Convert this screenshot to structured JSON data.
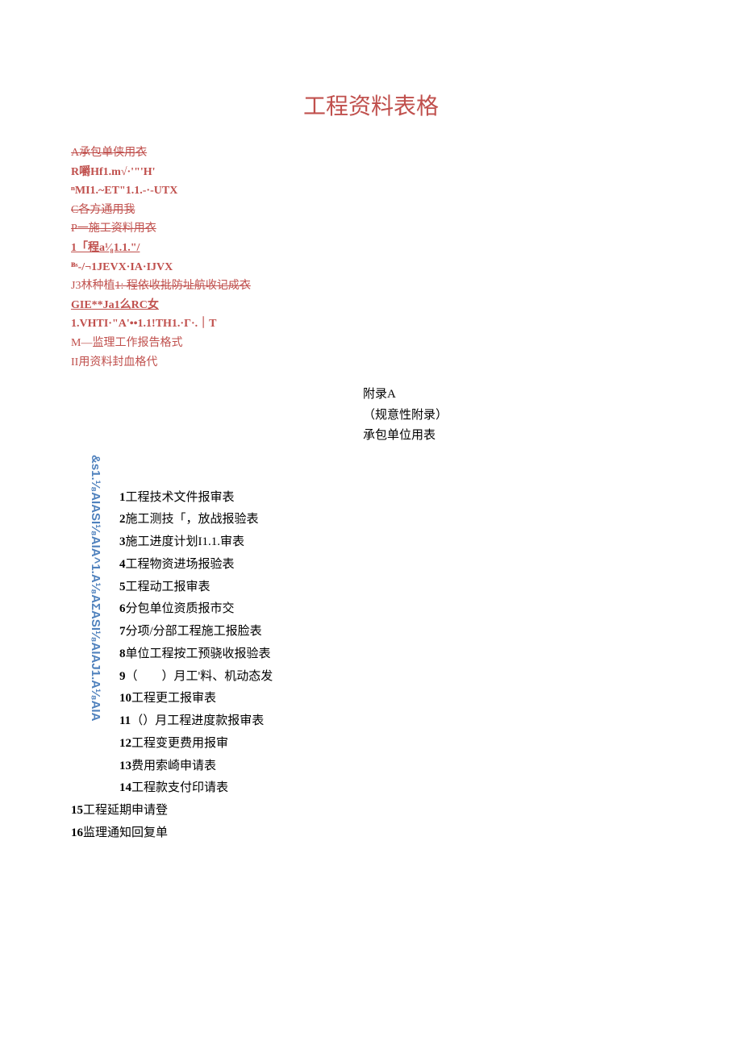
{
  "title": "工程资料表格",
  "toc": {
    "l1": "A承包单侠用衣",
    "l2a": "R嚼Hf1.m√·'\"'H'",
    "l2b": "ⁿMI1.~ET\"1.1.-·-UTX",
    "l3": "C各方通用我",
    "l4": "P一施工资料用衣",
    "l5a": "1「程a¹⁄₈1.1.\"/",
    "l5b": "ᴮˢ-/¬1JEVX·IA·IJVX",
    "l6a": "J3林种",
    "l6b": "植",
    "l6c": "1: 程依收批防址航收记成衣",
    "l7a": "GIE**Ja1么RC女",
    "l7b": "1.VHTI·\"A'••1.1!TH1.·Γ·.｜T",
    "l8": "M—监理工作报告格式",
    "l9": "II用资料封血格代"
  },
  "appendix": {
    "line1": "附录A",
    "line2": "（规意性附录）",
    "line3": "承包单位用表"
  },
  "vertical": "&s1.¹⁄₈AIASI¹⁄₈AIA^1.A¹⁄₈AΣASI¹⁄₈AIAJ1.A¹⁄₈AIA",
  "items": [
    {
      "n": "1",
      "t": "工程技术文件报审表"
    },
    {
      "n": "2",
      "t": "施工测技「，放战报验表"
    },
    {
      "n": "3",
      "t": "施工进度计划I1.1.审表"
    },
    {
      "n": "4",
      "t": "工程物资进场报验表"
    },
    {
      "n": "5",
      "t": "工程动工报审表"
    },
    {
      "n": "6",
      "t": "分包单位资质报市交"
    },
    {
      "n": "7",
      "t": "分项/分部工程施工报脸表"
    },
    {
      "n": "8",
      "t": "单位工程按工预骁收报验表"
    },
    {
      "n": "9",
      "t": "（　　）月工'料、机动态发"
    },
    {
      "n": "10",
      "t": "工程更工报审表"
    },
    {
      "n": "11",
      "t": "（）月工程进度款报审表"
    },
    {
      "n": "12",
      "t": "工程变更费用报审"
    },
    {
      "n": "13",
      "t": "费用索崎申请表"
    },
    {
      "n": "14",
      "t": "工程款支付印请表"
    }
  ],
  "tail": [
    {
      "n": "15",
      "t": "工程延期申请登"
    },
    {
      "n": "16",
      "t": "监理通知回复单"
    }
  ]
}
